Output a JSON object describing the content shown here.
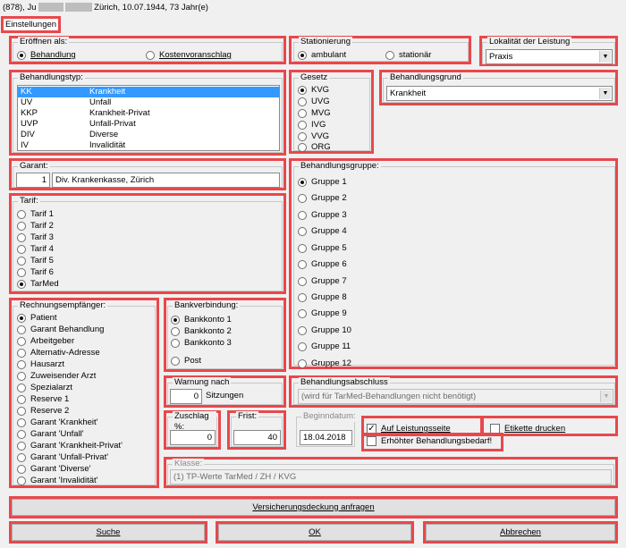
{
  "header": {
    "title_prefix": "(878), Ju",
    "title_suffix": " Zürich, 10.07.1944, 73 Jahr(e)",
    "tab": "Einstellungen"
  },
  "eroeffnen": {
    "label": "Eröffnen als:",
    "opt1": "Behandlung",
    "opt2": "Kostenvoranschlag"
  },
  "stationierung": {
    "label": "Stationierung",
    "opt1": "ambulant",
    "opt2": "stationär"
  },
  "lokalitaet": {
    "label": "Lokalität der Leistung",
    "value": "Praxis"
  },
  "behandlungstyp": {
    "label": "Behandlungstyp:",
    "items": [
      {
        "code": "KK",
        "name": "Krankheit"
      },
      {
        "code": "UV",
        "name": "Unfall"
      },
      {
        "code": "KKP",
        "name": "Krankheit-Privat"
      },
      {
        "code": "UVP",
        "name": "Unfall-Privat"
      },
      {
        "code": "DIV",
        "name": "Diverse"
      },
      {
        "code": "IV",
        "name": "Invalidität"
      }
    ]
  },
  "gesetz": {
    "label": "Gesetz",
    "options": [
      "KVG",
      "UVG",
      "MVG",
      "IVG",
      "VVG",
      "ORG"
    ]
  },
  "behandlungsgrund": {
    "label": "Behandlungsgrund",
    "value": "Krankheit"
  },
  "garant": {
    "label": "Garant:",
    "number": "1",
    "name": "Div. Krankenkasse, Zürich"
  },
  "tarif": {
    "label": "Tarif:",
    "options": [
      "Tarif 1",
      "Tarif 2",
      "Tarif 3",
      "Tarif 4",
      "Tarif 5",
      "Tarif 6",
      "TarMed"
    ]
  },
  "behandlungsgruppe": {
    "label": "Behandlungsgruppe:",
    "options": [
      "Gruppe 1",
      "Gruppe 2",
      "Gruppe 3",
      "Gruppe 4",
      "Gruppe 5",
      "Gruppe 6",
      "Gruppe 7",
      "Gruppe 8",
      "Gruppe 9",
      "Gruppe 10",
      "Gruppe 11",
      "Gruppe 12"
    ]
  },
  "rechnung": {
    "label": "Rechnungsempfänger:",
    "options": [
      "Patient",
      "Garant Behandlung",
      "Arbeitgeber",
      "Alternativ-Adresse",
      "Hausarzt",
      "Zuweisender Arzt",
      "Spezialarzt",
      "Reserve 1",
      "Reserve 2",
      "Garant 'Krankheit'",
      "Garant 'Unfall'",
      "Garant 'Krankheit-Privat'",
      "Garant 'Unfall-Privat'",
      "Garant 'Diverse'",
      "Garant 'Invalidität'"
    ]
  },
  "bank": {
    "label": "Bankverbindung:",
    "options": [
      "Bankkonto 1",
      "Bankkonto 2",
      "Bankkonto 3"
    ],
    "post": "Post"
  },
  "warnung": {
    "label": "Warnung nach",
    "value": "0",
    "unit": "Sitzungen"
  },
  "abschluss": {
    "label": "Behandlungsabschluss",
    "placeholder": "(wird für TarMed-Behandlungen nicht benötigt)"
  },
  "zuschlag": {
    "label": "Zuschlag %:",
    "value": "0"
  },
  "frist": {
    "label": "Frist:",
    "value": "40"
  },
  "beginn": {
    "label": "Beginndatum:",
    "value": "18.04.2018"
  },
  "checks": {
    "auf_leistungsseite": "Auf Leistungsseite",
    "etikette": "Etikette drucken",
    "erhoehter": "Erhöhter Behandlungsbedarf!"
  },
  "klasse": {
    "label": "Klasse:",
    "value": "(1) TP-Werte TarMed / ZH / KVG"
  },
  "buttons": {
    "versicherung": "Versicherungsdeckung anfragen",
    "suche": "Suche",
    "ok": "OK",
    "abbrechen": "Abbrechen"
  }
}
